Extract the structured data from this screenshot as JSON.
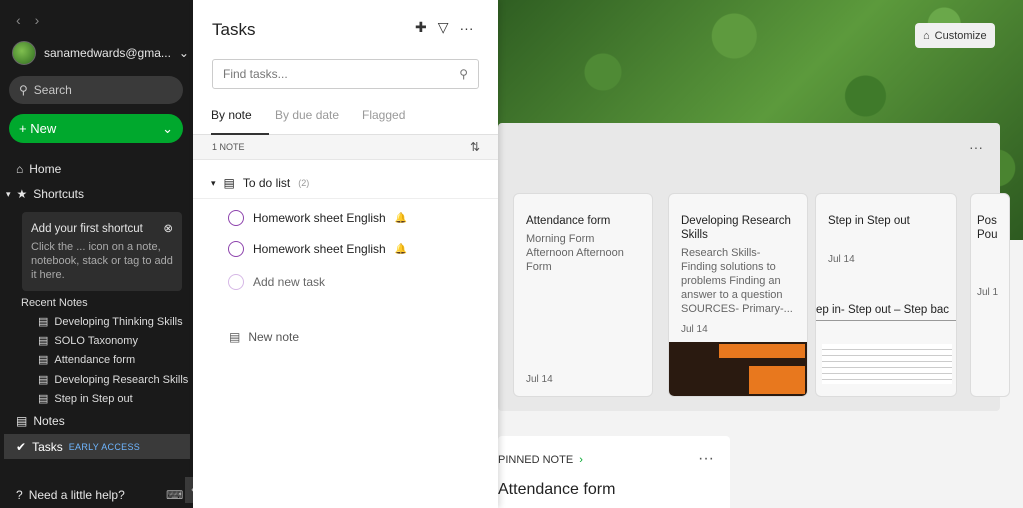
{
  "sidebar": {
    "account": "sanamedwards@gma...",
    "search": "Search",
    "new_label": "New",
    "home": "Home",
    "shortcuts": "Shortcuts",
    "shortcut_box": {
      "title": "Add your first shortcut",
      "body": "Click the ... icon on a note, notebook, stack or tag to add it here."
    },
    "recent_title": "Recent Notes",
    "recent": [
      "Developing Thinking Skills",
      "SOLO Taxonomy",
      "Attendance form",
      "Developing Research Skills",
      "Step in Step out"
    ],
    "notes": "Notes",
    "tasks": "Tasks",
    "tasks_badge": "EARLY ACCESS",
    "help": "Need a little help?"
  },
  "tasks_panel": {
    "title": "Tasks",
    "find_placeholder": "Find tasks...",
    "tabs": [
      "By note",
      "By due date",
      "Flagged"
    ],
    "note_count": "1 NOTE",
    "group": {
      "name": "To do list",
      "count": "(2)"
    },
    "items": [
      "Homework sheet English",
      "Homework sheet English"
    ],
    "add_task": "Add new task",
    "new_note": "New note"
  },
  "home": {
    "customize": "Customize",
    "cards": [
      {
        "title": "Attendance form",
        "body": "Morning Form Afternoon Afternoon Form",
        "date": "Jul 14"
      },
      {
        "title": "Developing Research Skills",
        "body": "Research Skills- Finding solutions to problems Finding an answer to a question SOURCES- Primary-...",
        "date": "Jul 14"
      },
      {
        "title": "Step in Step out",
        "body": "",
        "date": "Jul 14",
        "preview": "ep in- Step out – Step bac"
      },
      {
        "title": "Pos Pou",
        "body": "",
        "date": "Jul 1"
      }
    ],
    "pinned_label": "PINNED NOTE",
    "pinned_title": "Attendance form"
  }
}
